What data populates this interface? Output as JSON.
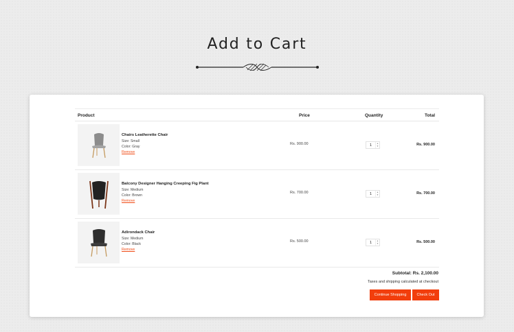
{
  "page": {
    "title": "Add to Cart"
  },
  "table": {
    "headers": {
      "product": "Product",
      "price": "Price",
      "quantity": "Quantity",
      "total": "Total"
    },
    "rows": [
      {
        "name": "Chairs Leatherette Chair",
        "size": "Size: Small",
        "color": "Color: Gray",
        "remove": "Remove",
        "price": "Rs. 900.00",
        "qty": "1",
        "total": "Rs. 900.00"
      },
      {
        "name": "Balcony Designer Hanging Creeping Fig Plant",
        "size": "Size: Medium",
        "color": "Color: Brown",
        "remove": "Remove",
        "price": "Rs. 700.00",
        "qty": "1",
        "total": "Rs. 700.00"
      },
      {
        "name": "Adirondack Chair",
        "size": "Size: Medium",
        "color": "Color: Black",
        "remove": "Remove",
        "price": "Rs. 500.00",
        "qty": "1",
        "total": "Rs. 500.00"
      }
    ]
  },
  "summary": {
    "subtotal": "Subtotal: Rs. 2,100.00",
    "taxes": "Taxes and shipping calculated at checkout",
    "continue_label": "Continue Shopping",
    "checkout_label": "Check Out"
  },
  "colors": {
    "accent": "#f23e0c",
    "background": "#ececec",
    "card": "#ffffff"
  },
  "icons": {
    "divider": "ornamental-divider-icon",
    "qty_arrows": "stepper-arrows-icon"
  }
}
